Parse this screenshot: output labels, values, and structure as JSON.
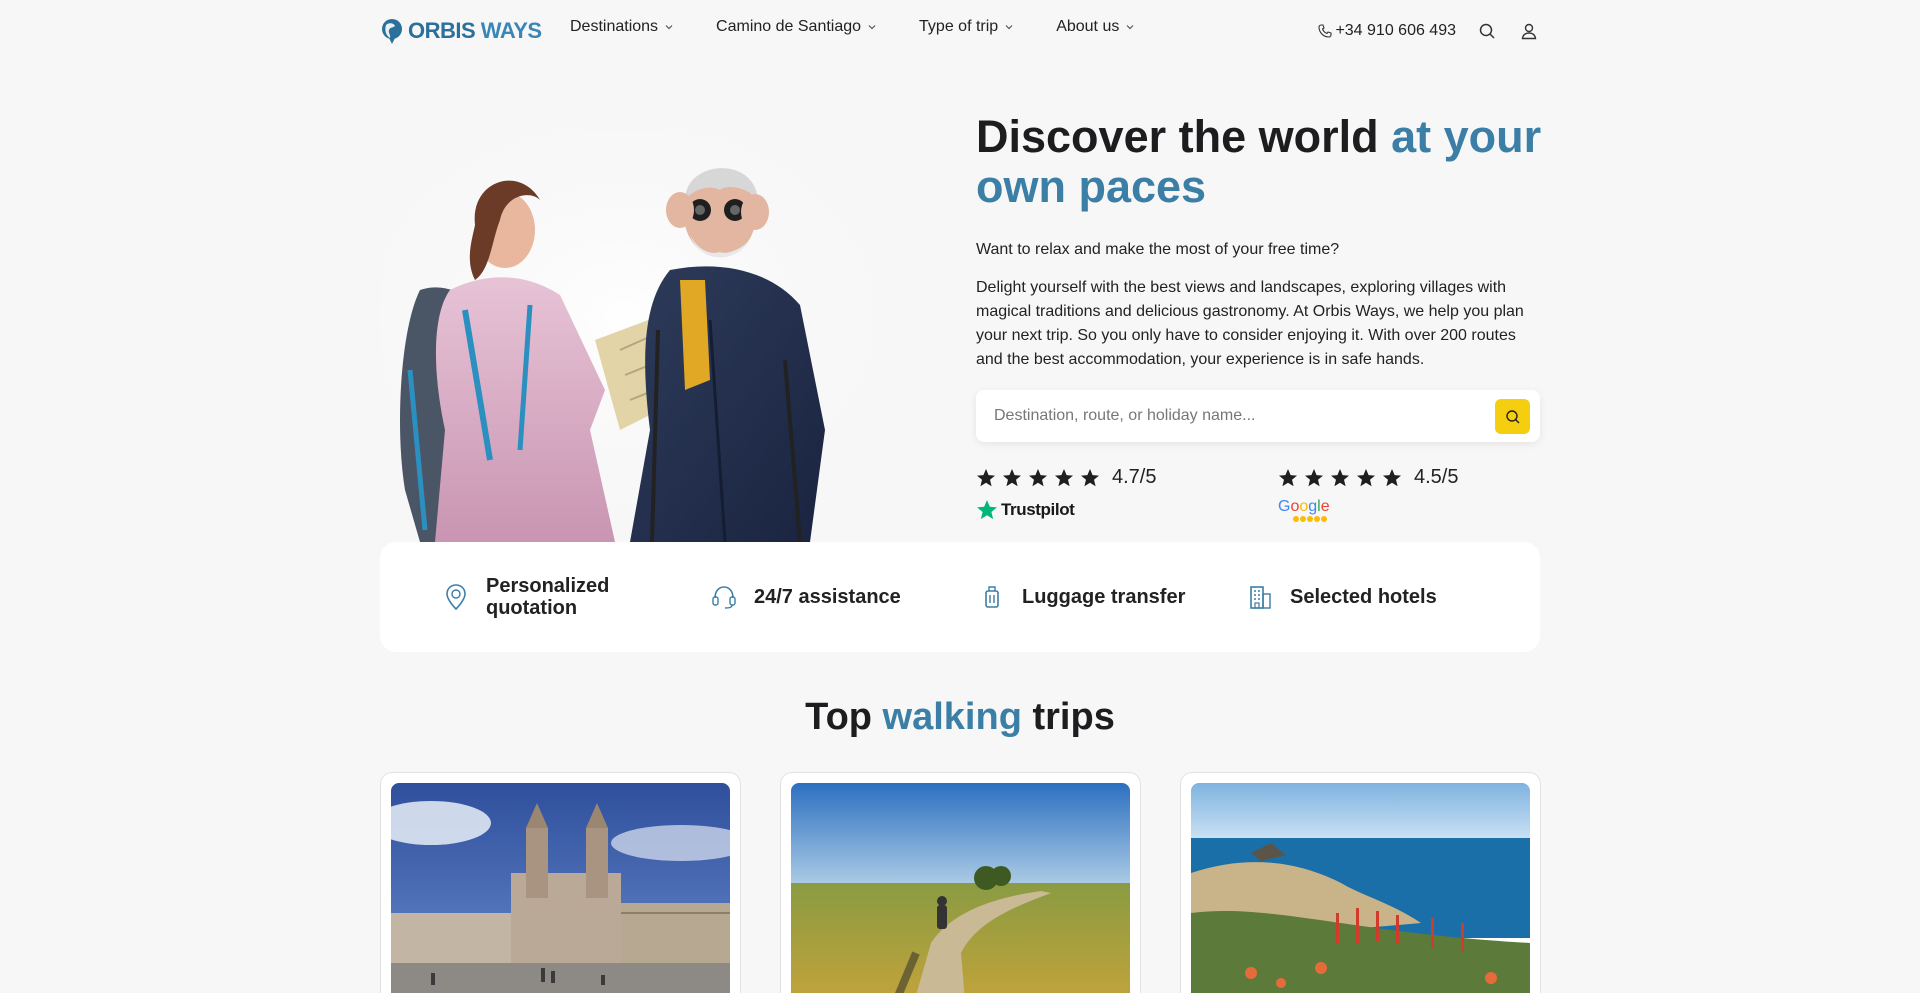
{
  "header": {
    "logo": {
      "part1": "ORBIS",
      "part2": " WAYS"
    },
    "nav": [
      {
        "label": "Destinations"
      },
      {
        "label": "Camino de Santiago"
      },
      {
        "label": "Type of trip"
      },
      {
        "label": "About us"
      }
    ],
    "phone": "+34 910 606 493"
  },
  "hero": {
    "title_part1": "Discover the world ",
    "title_accent": "at your own paces",
    "p1": "Want to relax and make the most of your free time?",
    "p2": "Delight yourself with the best views and landscapes, exploring villages with magical traditions and delicious gastronomy. At Orbis Ways, we help you plan your next trip. So you only have to consider enjoying it. With over 200 routes and the best accommodation, your experience is in safe hands.",
    "search_placeholder": "Destination, route, or holiday name...",
    "ratings": [
      {
        "value": "4.7/5",
        "brand": "Trustpilot",
        "stars": 5
      },
      {
        "value": "4.5/5",
        "brand": "Google",
        "stars": 5
      }
    ]
  },
  "features": [
    {
      "label": "Personalized quotation",
      "icon": "location-pin-icon"
    },
    {
      "label": "24/7 assistance",
      "icon": "headset-icon"
    },
    {
      "label": "Luggage transfer",
      "icon": "luggage-icon"
    },
    {
      "label": "Selected hotels",
      "icon": "building-icon"
    }
  ],
  "section": {
    "title_part1": "Top ",
    "title_accent": "walking",
    "title_part2": " trips"
  },
  "colors": {
    "accent": "#3b7ea6",
    "search_button": "#f5cf0f",
    "trustpilot_green": "#00b67a"
  }
}
